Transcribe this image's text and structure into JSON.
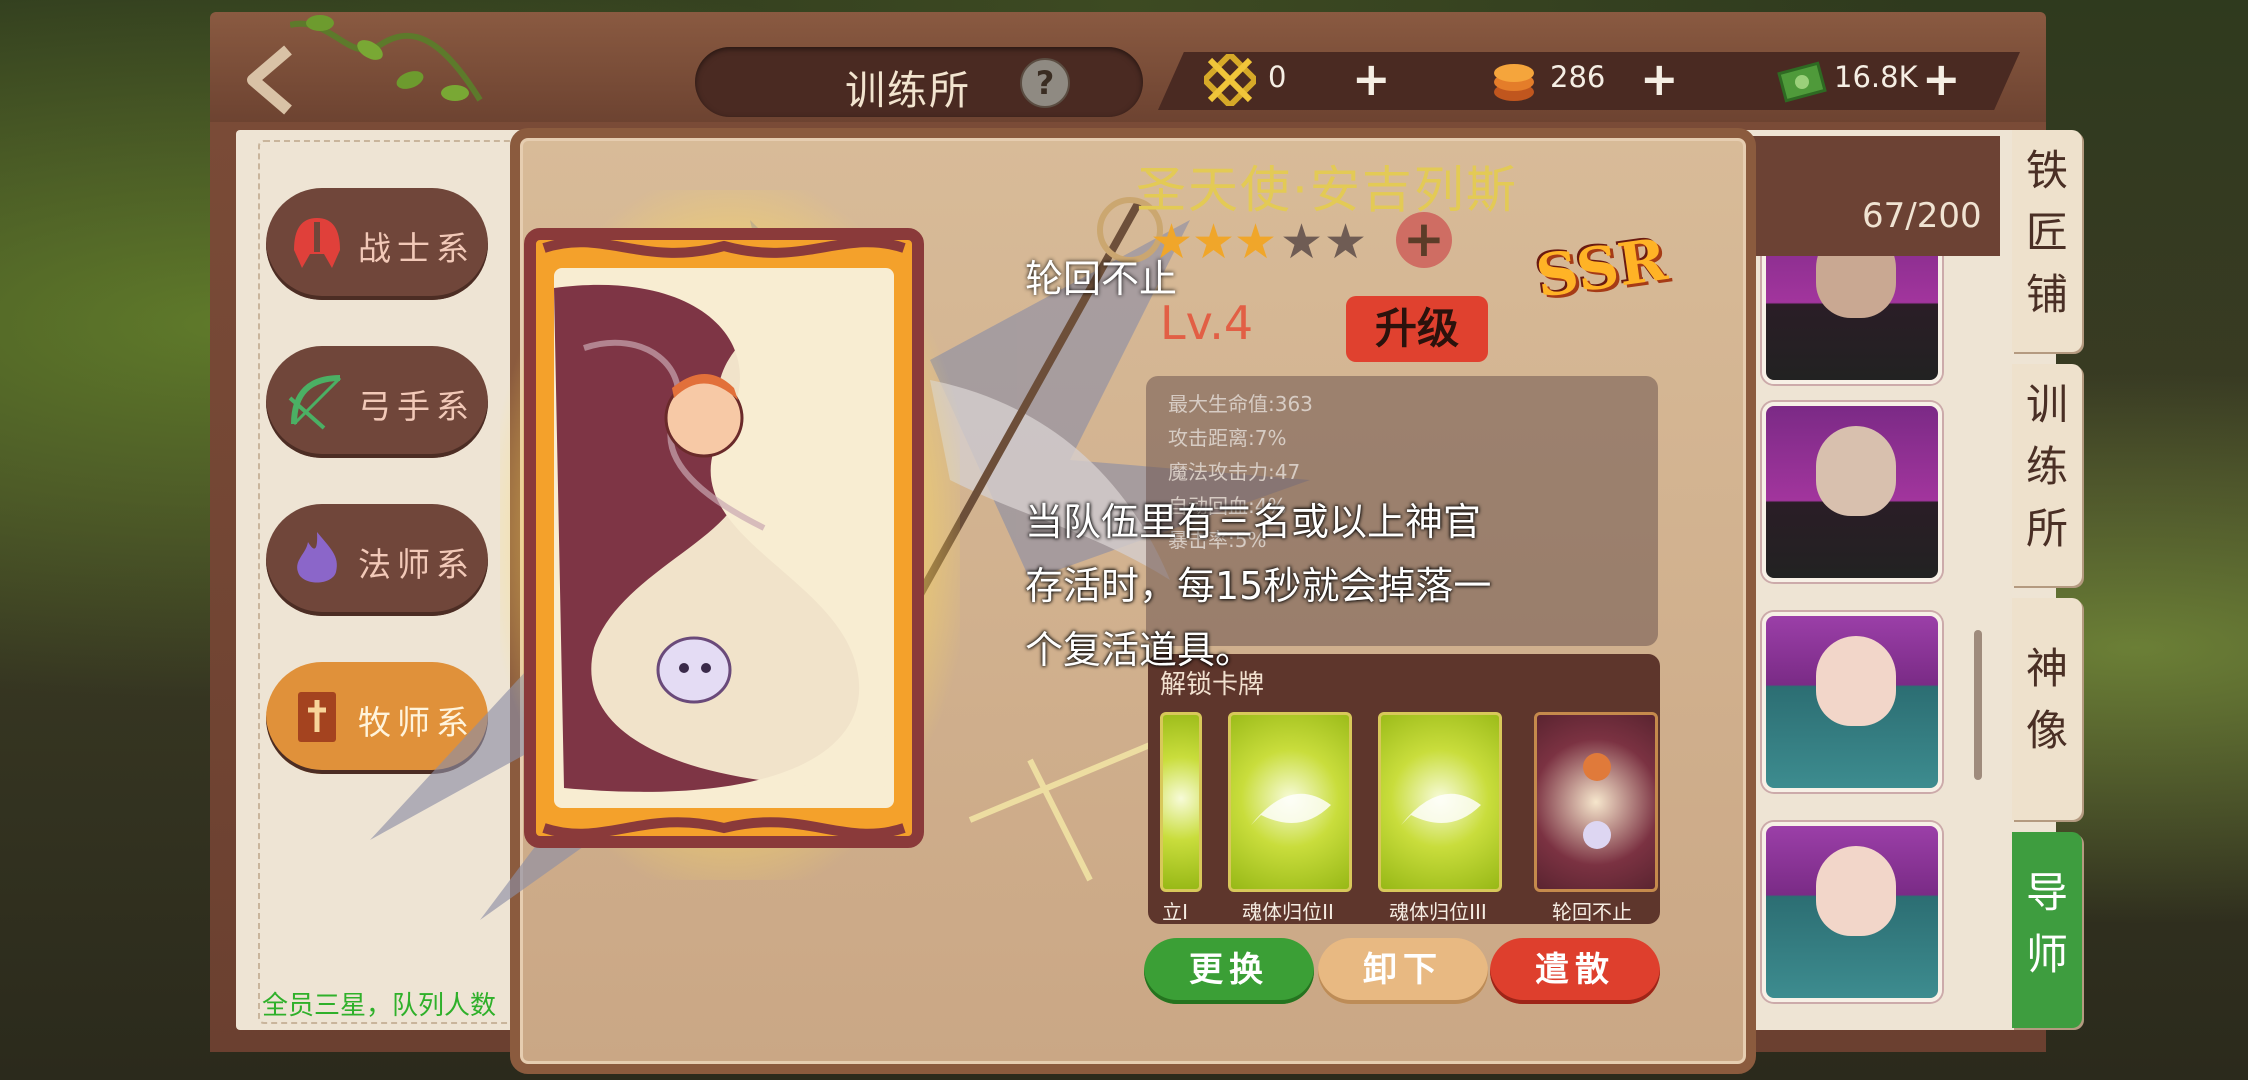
{
  "header": {
    "title": "训练所",
    "help_label": "?",
    "resources": [
      {
        "icon": "crossed-gold-icon",
        "value": "0",
        "plus": "+"
      },
      {
        "icon": "coin-stack-icon",
        "value": "286",
        "plus": "+"
      },
      {
        "icon": "cash-icon",
        "value": "16.8K",
        "plus": "+"
      }
    ]
  },
  "categories": [
    {
      "label": "战士系",
      "icon": "helmet-icon"
    },
    {
      "label": "弓手系",
      "icon": "bow-icon"
    },
    {
      "label": "法师系",
      "icon": "flame-icon"
    },
    {
      "label": "牧师系",
      "icon": "holy-book-icon"
    }
  ],
  "bottom_tip": "全员三星，队列人数",
  "hero": {
    "name": "圣天使·安吉列斯",
    "stars_filled": 3,
    "stars_total": 5,
    "star_plus": "+",
    "rarity": "SSR",
    "level": "Lv.4",
    "upgrade_label": "升级",
    "stats": [
      "最大生命值:363",
      "攻击距离:7%",
      "魔法攻击力:47",
      "自动回血:4%",
      "暴击率:5%"
    ]
  },
  "unlocked_cards": {
    "title": "解锁卡牌",
    "cards": [
      {
        "label": "立I",
        "style": "green"
      },
      {
        "label": "魂体归位II",
        "style": "green"
      },
      {
        "label": "魂体归位III",
        "style": "green"
      },
      {
        "label": "轮回不止",
        "style": "yin"
      }
    ]
  },
  "actions": {
    "replace": "更换",
    "unequip": "卸下",
    "dismiss": "遣散"
  },
  "roster": {
    "count": "67/200"
  },
  "side_tabs": [
    "铁匠铺",
    "训练所",
    "神像",
    "导师"
  ],
  "tooltip": {
    "title": "轮回不止",
    "body": "当队伍里有三名或以上神官存活时，每15秒就会掉落一个复活道具。"
  },
  "colors": {
    "accent_gold": "#e3ca55",
    "level_red": "#e25f45",
    "tab_green": "#3e9d3f"
  }
}
